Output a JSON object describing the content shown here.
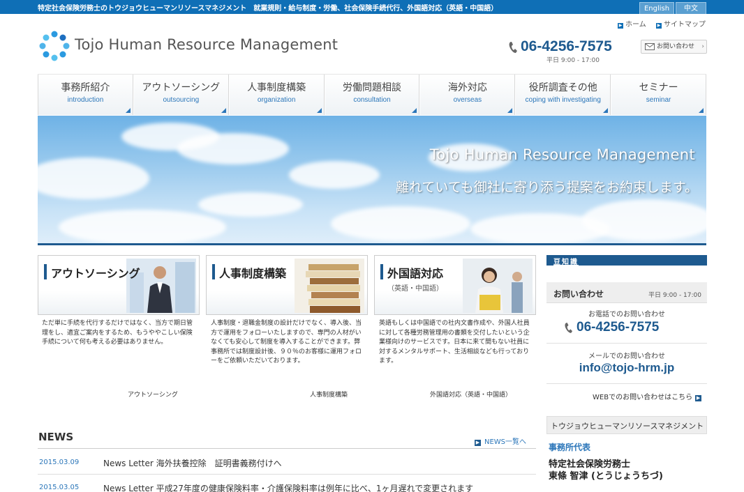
{
  "topbar": {
    "tagline": "特定社会保険労務士のトウジョウヒューマンリソースマネジメント　就業規則・給与制度・労働、社会保険手続代行、外国語対応（英語・中国語）",
    "lang_en": "English",
    "lang_zh": "中文"
  },
  "header": {
    "home": "ホーム",
    "sitemap": "サイトマップ",
    "logo_text": "Tojo Human Resource Management",
    "phone": "06-4256-7575",
    "hours": "平日 9:00 - 17:00",
    "contact_button": "お問い合わせ"
  },
  "nav": [
    {
      "jp": "事務所紹介",
      "en": "introduction"
    },
    {
      "jp": "アウトソーシング",
      "en": "outsourcing"
    },
    {
      "jp": "人事制度構築",
      "en": "organization"
    },
    {
      "jp": "労働問題相談",
      "en": "consultation"
    },
    {
      "jp": "海外対応",
      "en": "overseas"
    },
    {
      "jp": "役所調査その他",
      "en": "coping with investigating"
    },
    {
      "jp": "セミナー",
      "en": "seminar"
    }
  ],
  "hero": {
    "title": "Tojo Human Resource Management",
    "subtitle": "離れていても御社に寄り添う提案をお約束します。"
  },
  "features": [
    {
      "title": "アウトソーシング",
      "subtitle": "",
      "desc": "ただ単に手続を代行するだけではなく、当方で期日管理をし、適宜ご案内をするため、もうややこしい保険手続について何も考える必要はありません。",
      "link": "アウトソーシング"
    },
    {
      "title": "人事制度構築",
      "subtitle": "",
      "desc": "人事制度・退職金制度の設計だけでなく、導入後、当方で運用をフォローいたしますので、専門の人材がいなくても安心して制度を導入することができます。弊事務所では制度設計後、９０％のお客様に運用フォローをご依頼いただいております。",
      "link": "人事制度構築"
    },
    {
      "title": "外国語対応",
      "subtitle": "（英語・中国語）",
      "desc": "英語もしくは中国語での社内文書作成や、外国人社員に対して各種労務管理用の書類を交付したいという企業様向けのサービスです。日本に来て間もない社員に対するメンタルサポート、生活相談なども行っております。",
      "link": "外国語対応（英語・中国語）"
    }
  ],
  "news": {
    "title": "NEWS",
    "all_link": "NEWS一覧へ",
    "items": [
      {
        "date": "2015.03.09",
        "text": "News Letter 海外扶養控除　証明書義務付けへ"
      },
      {
        "date": "2015.03.05",
        "text": "News Letter 平成27年度の健康保険料率・介護保険料率は例年に比べ、1ヶ月遅れで変更されます"
      }
    ]
  },
  "sidebar": {
    "banner": "豆知識",
    "contact_title": "お問い合わせ",
    "contact_hours": "平日 9:00 - 17:00",
    "tel_label": "お電話でのお問い合わせ",
    "tel": "06-4256-7575",
    "mail_label": "メールでのお問い合わせ",
    "mail": "info@tojo-hrm.jp",
    "web_link": "WEBでのお問い合わせはこちら",
    "company": "トウジョウヒューマンリソースマネジメント",
    "rep_label": "事務所代表",
    "rep_title": "特定社会保険労務士",
    "rep_name": "東條 智津 (とうじょうちづ)"
  },
  "colors": {
    "brand_blue": "#0f6fb6",
    "dark_blue": "#1e5a8f",
    "link_blue": "#2b76b9"
  }
}
